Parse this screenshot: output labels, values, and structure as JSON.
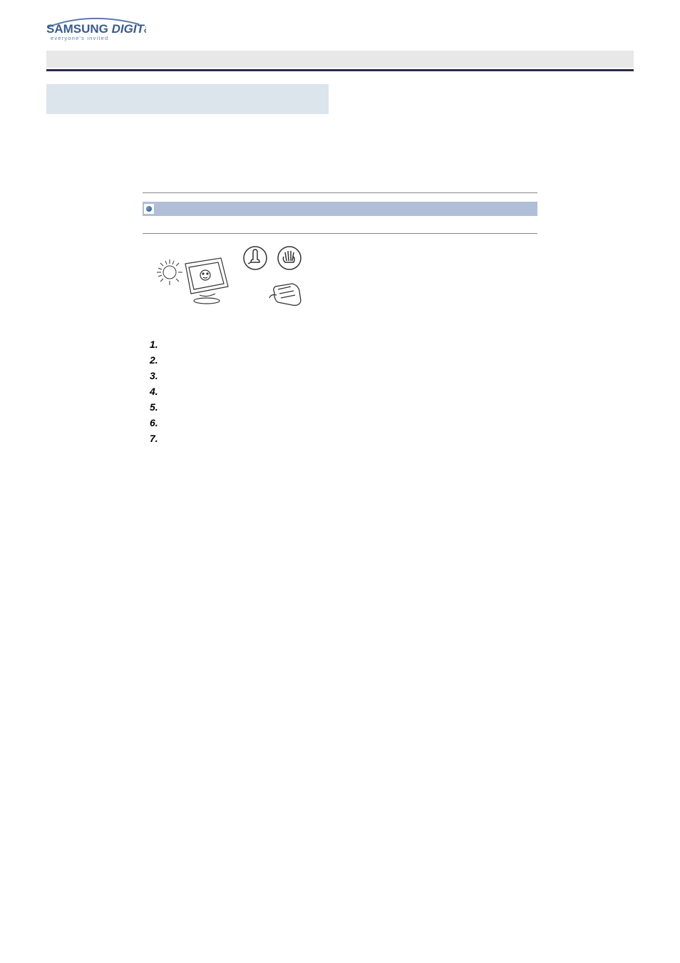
{
  "logo": {
    "brand": "SAMSUNG",
    "suffix1": "DIGIT",
    "suffix2": "all",
    "tagline": "everyone's invited"
  },
  "list": {
    "items": [
      {
        "num": "1."
      },
      {
        "num": "2."
      },
      {
        "num": "3."
      },
      {
        "num": "4."
      },
      {
        "num": "5."
      },
      {
        "num": "6."
      },
      {
        "num": "7."
      }
    ]
  }
}
